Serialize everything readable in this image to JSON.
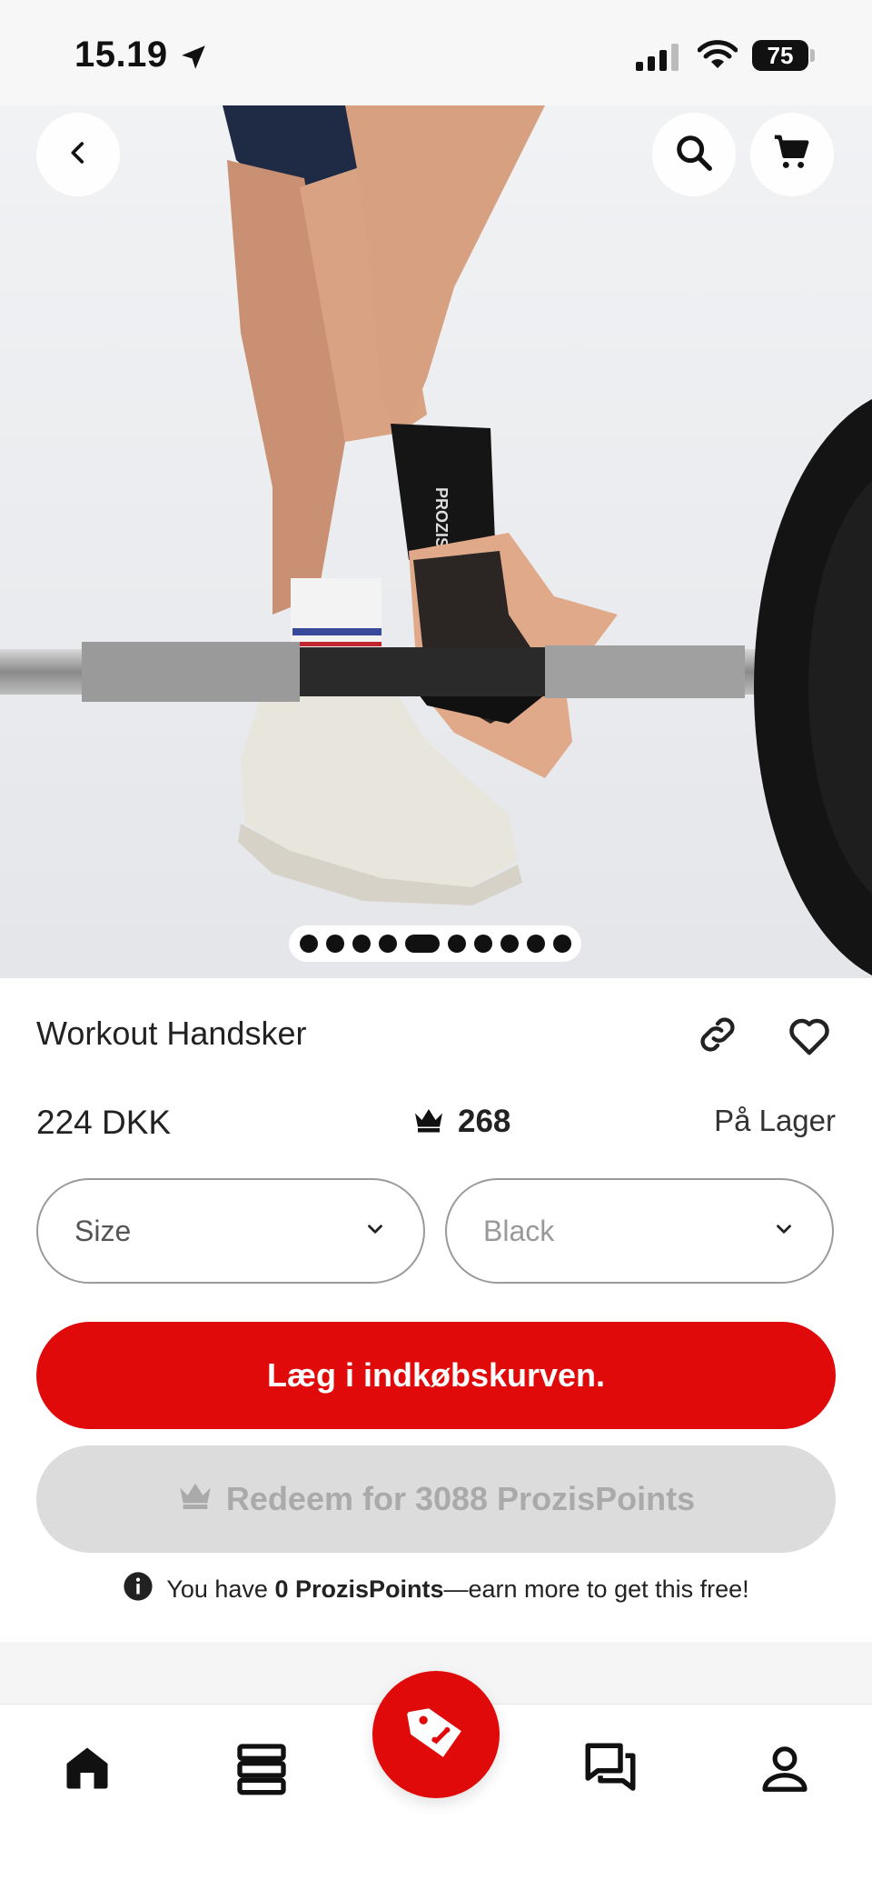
{
  "status_bar": {
    "time": "15.19",
    "battery": "75"
  },
  "carousel": {
    "total_images": 10,
    "active_index": 4
  },
  "product": {
    "title": "Workout Handsker",
    "price": "224 DKK",
    "points": "268",
    "stock": "På Lager"
  },
  "options": {
    "size_label": "Size",
    "color_label": "Black"
  },
  "buttons": {
    "add_to_cart": "Læg i indkøbskurven.",
    "redeem": "Redeem for 3088 ProzisPoints"
  },
  "note": {
    "prefix": "You have ",
    "bold": "0 ProzisPoints",
    "suffix": "—earn more to get this free!"
  },
  "icons": {
    "back": "back-icon",
    "search": "search-icon",
    "cart": "cart-icon",
    "link": "link-icon",
    "favorite": "heart-icon",
    "crown": "crown-icon",
    "info": "info-icon",
    "home": "home-icon",
    "catalog": "catalog-icon",
    "offers": "tag-icon",
    "messages": "chat-icon",
    "profile": "profile-icon"
  },
  "colors": {
    "accent": "#e10a0a",
    "disabled_button": "#dcdcdc"
  }
}
